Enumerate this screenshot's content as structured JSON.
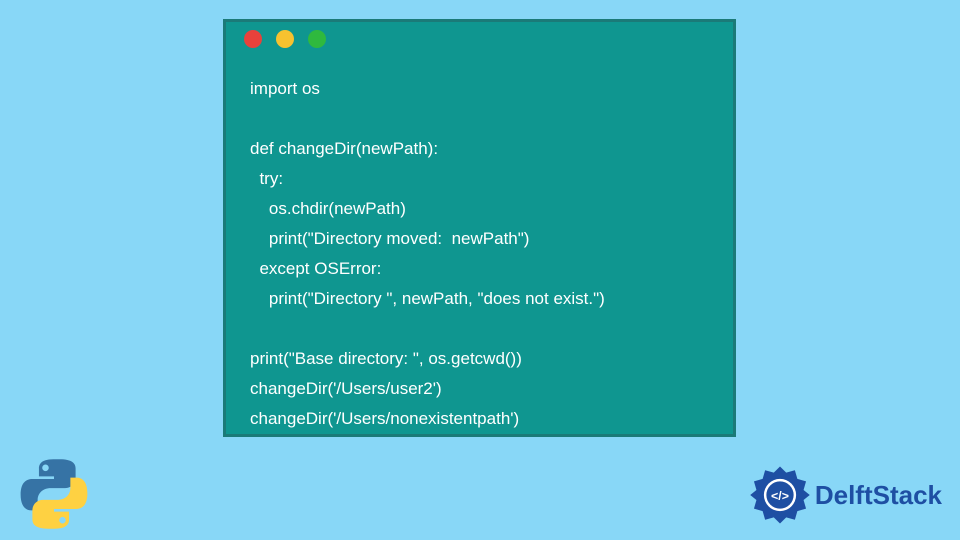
{
  "code": {
    "lines": [
      "import os",
      "",
      "def changeDir(newPath):",
      "  try:",
      "    os.chdir(newPath)",
      "    print(\"Directory moved:  newPath\")",
      "  except OSError:",
      "    print(\"Directory \", newPath, \"does not exist.\")",
      "",
      "print(\"Base directory: \", os.getcwd())",
      "changeDir('/Users/user2')",
      "changeDir('/Users/nonexistentpath')"
    ]
  },
  "branding": {
    "site_name": "DelftStack"
  },
  "colors": {
    "background": "#88d7f7",
    "window": "#0f9690",
    "border": "#1b7a78",
    "dot_red": "#e8413b",
    "dot_yellow": "#f7c22f",
    "dot_green": "#2fb93e",
    "text": "#ffffff",
    "brand": "#1e4fa3"
  }
}
